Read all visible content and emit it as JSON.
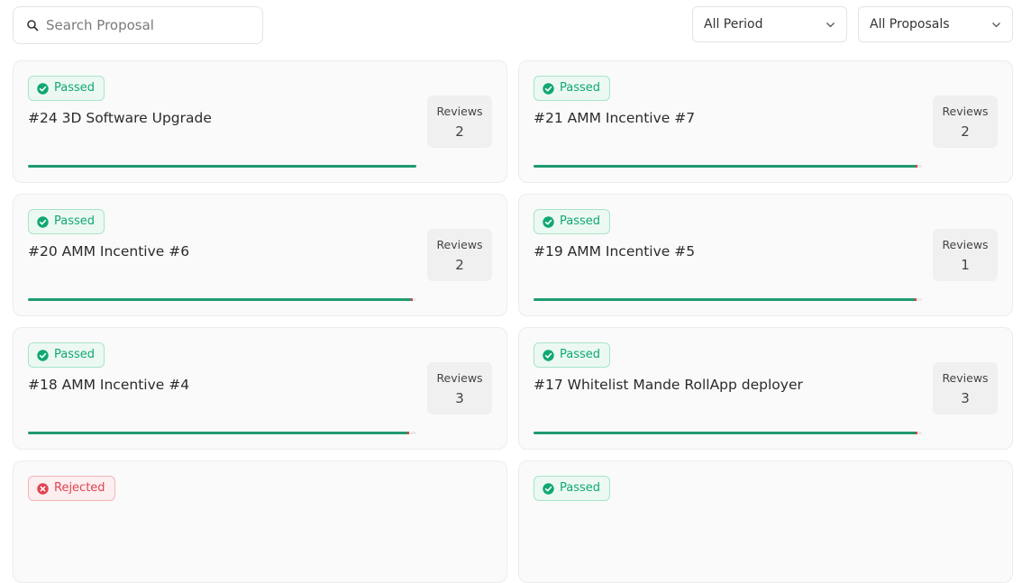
{
  "search": {
    "placeholder": "Search Proposal",
    "value": ""
  },
  "filters": {
    "period": "All Period",
    "proposals": "All Proposals"
  },
  "colors": {
    "passed": "#10a870",
    "rejected": "#e0434f",
    "yes_bar": "#1f9a6e"
  },
  "proposals": [
    {
      "status": "Passed",
      "title": "#24 3D Software Upgrade",
      "reviews_label": "Reviews",
      "reviews": "2",
      "yes_fraction": 1.0,
      "no_fraction": 0.0
    },
    {
      "status": "Passed",
      "title": "#21 AMM Incentive #7",
      "reviews_label": "Reviews",
      "reviews": "2",
      "yes_fraction": 0.984,
      "no_fraction": 0.005
    },
    {
      "status": "Passed",
      "title": "#20 AMM Incentive #6",
      "reviews_label": "Reviews",
      "reviews": "2",
      "yes_fraction": 0.985,
      "no_fraction": 0.005
    },
    {
      "status": "Passed",
      "title": "#19 AMM Incentive #5",
      "reviews_label": "Reviews",
      "reviews": "1",
      "yes_fraction": 0.982,
      "no_fraction": 0.005
    },
    {
      "status": "Passed",
      "title": "#18 AMM Incentive #4",
      "reviews_label": "Reviews",
      "reviews": "3",
      "yes_fraction": 0.977,
      "no_fraction": 0.005
    },
    {
      "status": "Passed",
      "title": "#17 Whitelist Mande RollApp deployer",
      "reviews_label": "Reviews",
      "reviews": "3",
      "yes_fraction": 0.984,
      "no_fraction": 0.005
    },
    {
      "status": "Rejected",
      "title": "",
      "reviews_label": "",
      "reviews": "",
      "yes_fraction": 0,
      "no_fraction": 0
    },
    {
      "status": "Passed",
      "title": "",
      "reviews_label": "",
      "reviews": "",
      "yes_fraction": 0,
      "no_fraction": 0
    }
  ]
}
